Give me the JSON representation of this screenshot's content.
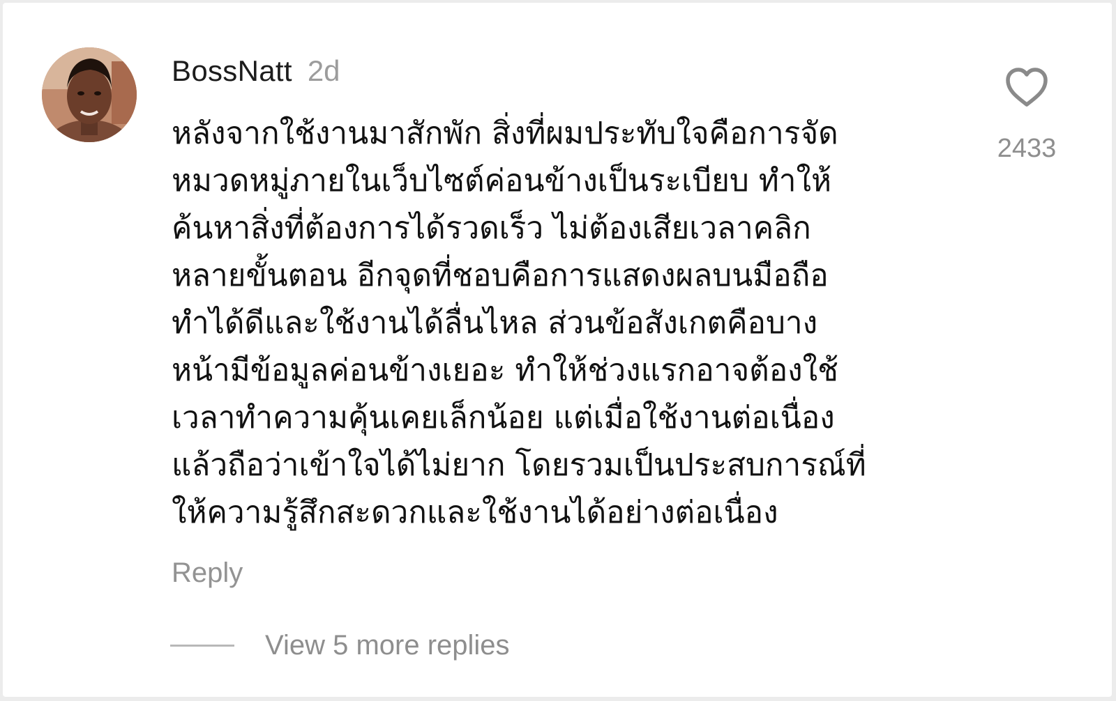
{
  "comment": {
    "username": "BossNatt",
    "time_ago": "2d",
    "lines": [
      "หลังจากใช้งานมาสักพัก สิ่งที่ผมประทับใจคือการจัด",
      "หมวดหมู่ภายในเว็บไซต์ค่อนข้างเป็นระเบียบ ทำให้",
      "ค้นหาสิ่งที่ต้องการได้รวดเร็ว ไม่ต้องเสียเวลาคลิก",
      "หลายขั้นตอน อีกจุดที่ชอบคือการแสดงผลบนมือถือ",
      "ทำได้ดีและใช้งานได้ลื่นไหล ส่วนข้อสังเกตคือบาง",
      "หน้ามีข้อมูลค่อนข้างเยอะ ทำให้ช่วงแรกอาจต้องใช้",
      "เวลาทำความคุ้นเคยเล็กน้อย แต่เมื่อใช้งานต่อเนื่อง",
      "แล้วถือว่าเข้าใจได้ไม่ยาก โดยรวมเป็นประสบการณ์ที่",
      "ให้ความรู้สึกสะดวกและใช้งานได้อย่างต่อเนื่อง"
    ],
    "like_count": "2433",
    "reply_label": "Reply",
    "view_replies_label": "View 5 more replies"
  },
  "icons": {
    "like": "heart-outline-icon",
    "avatar": "user-avatar-photo"
  },
  "colors": {
    "username": "#1c1c1c",
    "muted_text": "#8e8e8e",
    "body_text": "#111111",
    "background": "#ffffff"
  }
}
